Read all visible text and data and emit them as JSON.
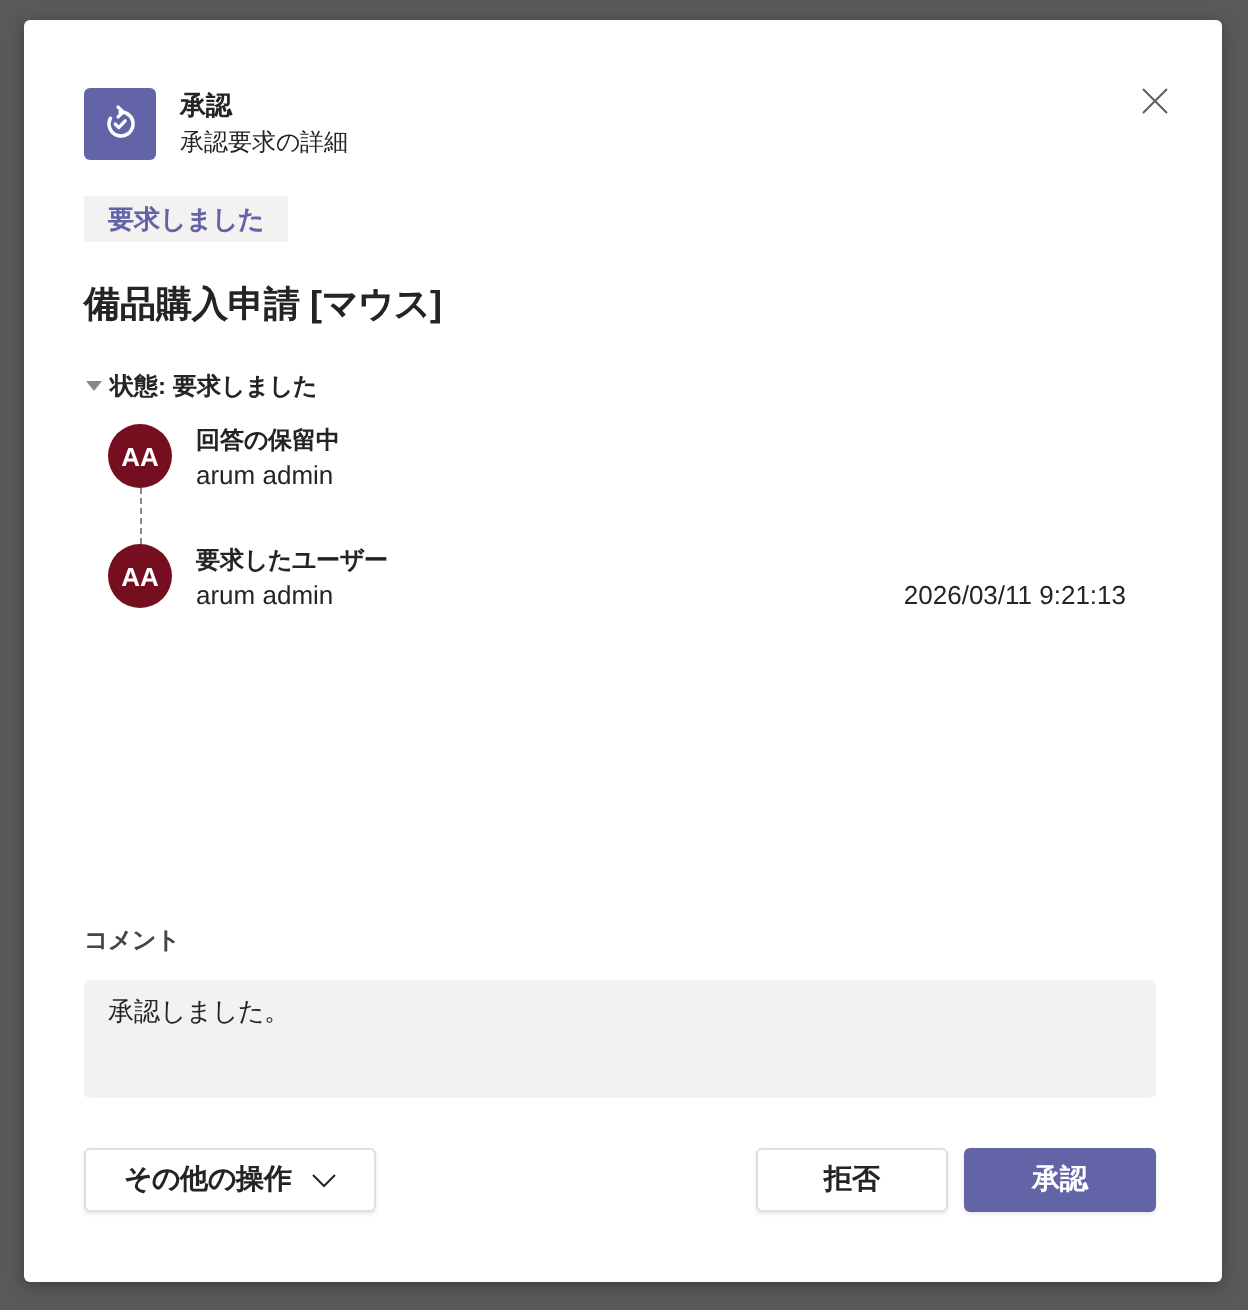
{
  "dialog": {
    "app_title": "承認",
    "app_subtitle": "承認要求の詳細",
    "status_badge": "要求しました",
    "request_title": "備品購入申請 [マウス]",
    "status_section": {
      "label": "状態: 要求しました",
      "expanded": true,
      "entries": [
        {
          "initials": "AA",
          "role": "回答の保留中",
          "name": "arum admin"
        },
        {
          "initials": "AA",
          "role": "要求したユーザー",
          "name": "arum admin",
          "timestamp": "2026/03/11 9:21:13"
        }
      ]
    },
    "comment": {
      "label": "コメント",
      "value": "承認しました。"
    },
    "buttons": [
      {
        "label": "その他の操作",
        "kind": "menu"
      },
      {
        "label": "拒否",
        "kind": "secondary"
      },
      {
        "label": "承認",
        "kind": "primary"
      }
    ]
  }
}
